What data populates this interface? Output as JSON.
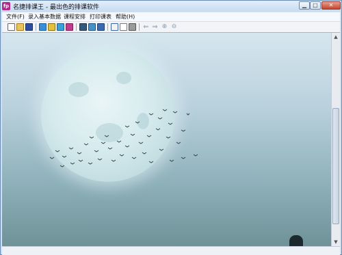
{
  "window": {
    "title": "名捷排课王 - 最出色的排课软件",
    "app_icon_label": "fp",
    "minimize_icon": "minimize-icon",
    "maximize_icon": "maximize-icon",
    "close_icon": "close-icon"
  },
  "menu": {
    "items": [
      {
        "label": "文件(F)"
      },
      {
        "label": "录入基本数据"
      },
      {
        "label": "课程安排"
      },
      {
        "label": "打印课表"
      },
      {
        "label": "帮助(H)"
      }
    ]
  },
  "toolbar": {
    "icons": [
      "new-file-icon",
      "open-folder-icon",
      "save-icon",
      "home-icon",
      "user-icon",
      "table-icon",
      "chart-icon",
      "photo-icon",
      "schedule-icon",
      "monitor-icon",
      "book-icon",
      "preview-icon",
      "print-icon",
      "arrow-left-icon",
      "arrow-right-icon",
      "zoom-in-icon",
      "zoom-out-icon"
    ]
  },
  "colors": {
    "titlebar": "#c7dbf1",
    "close_button": "#c7442c",
    "app_icon": "#b22a8a",
    "sky_top": "#d6e6ef",
    "sky_bottom": "#6f9298"
  },
  "content": {
    "image": "moon-with-flying-birds"
  }
}
